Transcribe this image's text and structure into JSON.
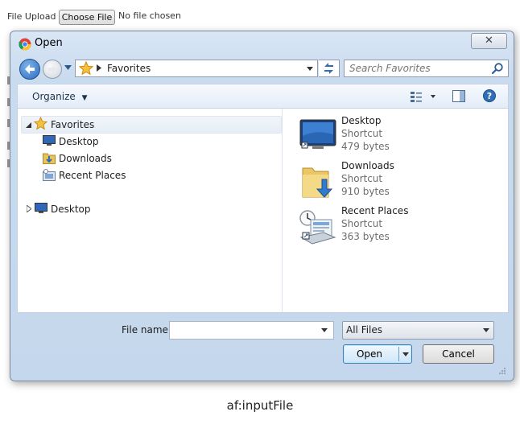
{
  "page": {
    "file_upload_label": "File Upload",
    "choose_file_button": "Choose File",
    "no_file_text": "No file chosen",
    "caption": "af:inputFile"
  },
  "dialog": {
    "title": "Open",
    "address": {
      "path": [
        "Favorites"
      ]
    },
    "search": {
      "placeholder": "Search Favorites"
    },
    "toolbar": {
      "organize_label": "Organize"
    },
    "nav_tree": [
      {
        "label": "Favorites",
        "icon": "star-icon",
        "expanded": true
      },
      {
        "label": "Desktop",
        "icon": "desktop-icon"
      },
      {
        "label": "Downloads",
        "icon": "downloads-icon"
      },
      {
        "label": "Recent Places",
        "icon": "recent-places-icon"
      },
      {
        "label": "Desktop",
        "icon": "desktop-icon",
        "expanded": false
      }
    ],
    "files": [
      {
        "name": "Desktop",
        "type": "Shortcut",
        "size": "479 bytes",
        "icon": "desktop-icon"
      },
      {
        "name": "Downloads",
        "type": "Shortcut",
        "size": "910 bytes",
        "icon": "downloads-folder-icon"
      },
      {
        "name": "Recent Places",
        "type": "Shortcut",
        "size": "363 bytes",
        "icon": "recent-places-icon"
      }
    ],
    "filename_label": "File name:",
    "filename_value": "",
    "filetype_value": "All Files",
    "open_label": "Open",
    "cancel_label": "Cancel"
  }
}
